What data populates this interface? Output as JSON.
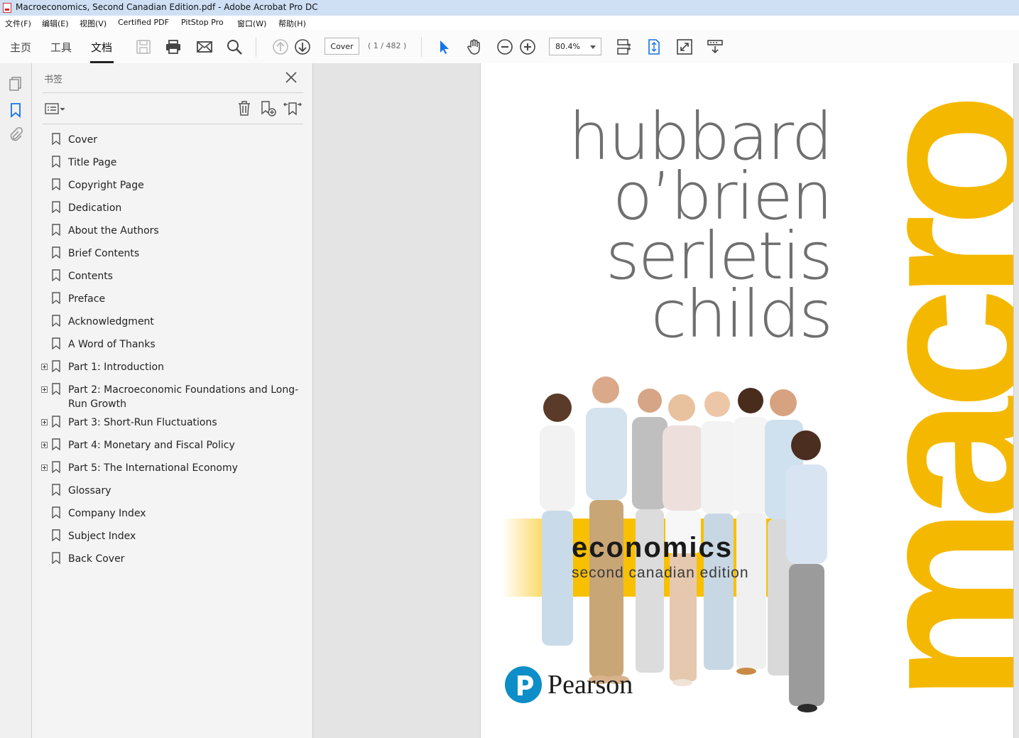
{
  "window": {
    "title": "Macroeconomics, Second Canadian Edition.pdf - Adobe Acrobat Pro DC"
  },
  "menu": [
    "文件(F)",
    "编辑(E)",
    "视图(V)",
    "Certified PDF",
    "PitStop Pro",
    "窗口(W)",
    "帮助(H)"
  ],
  "toolbar": {
    "tabs": [
      "主页",
      "工具",
      "文档"
    ],
    "page_field": "Cover",
    "page_count": "( 1 / 482 )",
    "zoom": "80.4%"
  },
  "bookmarks": {
    "title": "书签",
    "items": [
      {
        "label": "Cover",
        "expandable": false
      },
      {
        "label": "Title Page",
        "expandable": false
      },
      {
        "label": "Copyright Page",
        "expandable": false
      },
      {
        "label": "Dedication",
        "expandable": false
      },
      {
        "label": "About the Authors",
        "expandable": false
      },
      {
        "label": "Brief Contents",
        "expandable": false
      },
      {
        "label": "Contents",
        "expandable": false
      },
      {
        "label": "Preface",
        "expandable": false
      },
      {
        "label": "Acknowledgment",
        "expandable": false
      },
      {
        "label": "A Word of Thanks",
        "expandable": false
      },
      {
        "label": "Part 1: Introduction",
        "expandable": true
      },
      {
        "label": "Part 2: Macroeconomic Foundations and Long-Run Growth",
        "expandable": true
      },
      {
        "label": "Part 3: Short-Run Fluctuations",
        "expandable": true
      },
      {
        "label": "Part 4: Monetary and Fiscal Policy",
        "expandable": true
      },
      {
        "label": "Part 5: The International Economy",
        "expandable": true
      },
      {
        "label": "Glossary",
        "expandable": false
      },
      {
        "label": "Company Index",
        "expandable": false
      },
      {
        "label": "Subject Index",
        "expandable": false
      },
      {
        "label": "Back Cover",
        "expandable": false
      }
    ]
  },
  "cover": {
    "authors": [
      "hubbard",
      "o’brien",
      "serletis",
      "childs"
    ],
    "big_word": "macro",
    "subtitle_main": "economics",
    "subtitle_edition": "second canadian edition",
    "publisher": "Pearson",
    "accent_color": "#f5b800",
    "publisher_color": "#0d8ec8"
  }
}
